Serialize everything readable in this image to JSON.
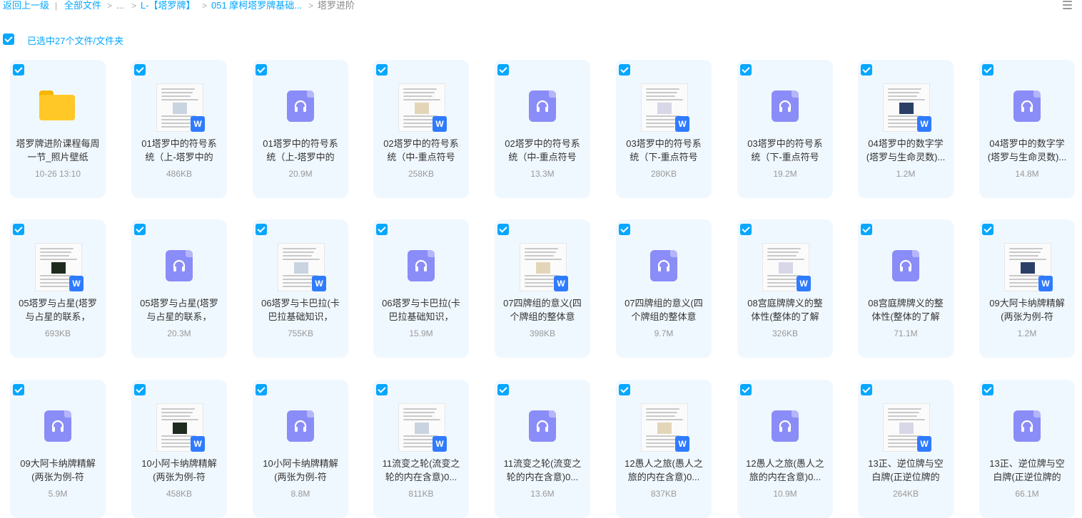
{
  "breadcrumb": {
    "back": "返回上一级",
    "divider": "|",
    "all_files": "全部文件",
    "sep": ">",
    "ellipsis": "...",
    "level1": "L-【塔罗牌】",
    "level2": "051 摩柯塔罗牌基础...",
    "current": "塔罗进阶"
  },
  "selection": {
    "text": "已选中27个文件/文件夹"
  },
  "files": [
    {
      "type": "folder",
      "name": "塔罗牌进阶课程每周一节_照片壁纸",
      "meta": "10-26 13:10"
    },
    {
      "type": "doc",
      "name": "01塔罗中的符号系统（上-塔罗中的",
      "meta": "486KB"
    },
    {
      "type": "audio",
      "name": "01塔罗中的符号系统（上-塔罗中的",
      "meta": "20.9M"
    },
    {
      "type": "doc",
      "name": "02塔罗中的符号系统（中-重点符号",
      "meta": "258KB"
    },
    {
      "type": "audio",
      "name": "02塔罗中的符号系统（中-重点符号",
      "meta": "13.3M"
    },
    {
      "type": "doc",
      "name": "03塔罗中的符号系统（下-重点符号",
      "meta": "280KB"
    },
    {
      "type": "audio",
      "name": "03塔罗中的符号系统（下-重点符号",
      "meta": "19.2M"
    },
    {
      "type": "doc",
      "name": "04塔罗中的数字学(塔罗与生命灵数)...",
      "meta": "1.2M"
    },
    {
      "type": "audio",
      "name": "04塔罗中的数字学(塔罗与生命灵数)...",
      "meta": "14.8M"
    },
    {
      "type": "doc",
      "name": "05塔罗与占星(塔罗与占星的联系，",
      "meta": "693KB"
    },
    {
      "type": "audio",
      "name": "05塔罗与占星(塔罗与占星的联系，",
      "meta": "20.3M"
    },
    {
      "type": "doc",
      "name": "06塔罗与卡巴拉(卡巴拉基础知识，",
      "meta": "755KB"
    },
    {
      "type": "audio",
      "name": "06塔罗与卡巴拉(卡巴拉基础知识，",
      "meta": "15.9M"
    },
    {
      "type": "doc",
      "name": "07四牌组的意义(四个牌组的整体意",
      "meta": "398KB"
    },
    {
      "type": "audio",
      "name": "07四牌组的意义(四个牌组的整体意",
      "meta": "9.7M"
    },
    {
      "type": "doc",
      "name": "08宫庭牌牌义的整体性(整体的了解",
      "meta": "326KB"
    },
    {
      "type": "audio",
      "name": "08宫庭牌牌义的整体性(整体的了解",
      "meta": "71.1M"
    },
    {
      "type": "doc",
      "name": "09大阿卡纳牌精解(两张为例-符",
      "meta": "1.2M"
    },
    {
      "type": "audio",
      "name": "09大阿卡纳牌精解(两张为例-符",
      "meta": "5.9M"
    },
    {
      "type": "doc",
      "name": "10小阿卡纳牌精解(两张为例-符",
      "meta": "458KB"
    },
    {
      "type": "audio",
      "name": "10小阿卡纳牌精解(两张为例-符",
      "meta": "8.8M"
    },
    {
      "type": "doc",
      "name": "11流变之轮(流变之轮的内在含意)0...",
      "meta": "811KB"
    },
    {
      "type": "audio",
      "name": "11流变之轮(流变之轮的内在含意)0...",
      "meta": "13.6M"
    },
    {
      "type": "doc",
      "name": "12愚人之旅(愚人之旅的内在含意)0...",
      "meta": "837KB"
    },
    {
      "type": "audio",
      "name": "12愚人之旅(愚人之旅的内在含意)0...",
      "meta": "10.9M"
    },
    {
      "type": "doc",
      "name": "13正、逆位牌与空白牌(正逆位牌的",
      "meta": "264KB"
    },
    {
      "type": "audio",
      "name": "13正、逆位牌与空白牌(正逆位牌的",
      "meta": "66.1M"
    }
  ],
  "colors": {
    "accent": "#06a7ff",
    "card_bg": "#f0f8ff",
    "audio": "#8a8cf7",
    "word": "#2f7bff",
    "folder": "#ffc826"
  },
  "icons": {
    "folder": "folder-icon",
    "audio": "audio-file-icon",
    "doc": "word-doc-icon",
    "check": "checkbox-checked-icon",
    "view": "list-view-icon"
  }
}
